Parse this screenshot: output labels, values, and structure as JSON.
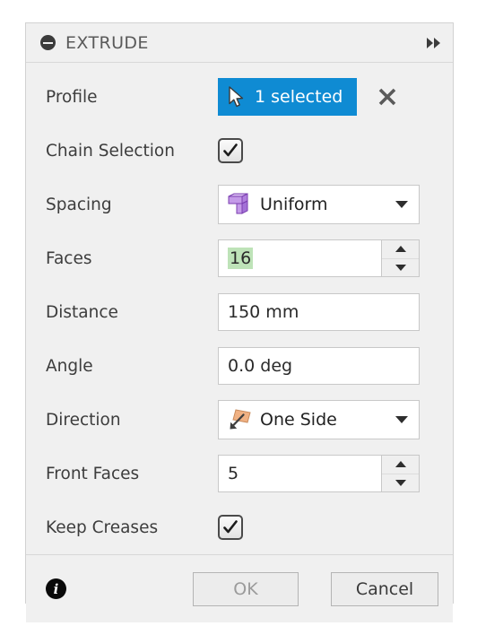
{
  "panel": {
    "title": "EXTRUDE",
    "collapse_icon": "collapse-minus-icon",
    "expand_icon": "fast-forward-icon",
    "accent_blue": "#0f8bd3",
    "highlight_green": "#bee3b8"
  },
  "rows": {
    "profile": {
      "label": "Profile",
      "button_text": "1 selected",
      "button_icon": "cursor-arrow-icon",
      "clear_icon": "close-x-icon"
    },
    "chain_selection": {
      "label": "Chain Selection",
      "checked": true
    },
    "spacing": {
      "label": "Spacing",
      "value": "Uniform",
      "icon": "extrude-uniform-icon"
    },
    "faces": {
      "label": "Faces",
      "value": "16",
      "selected": true
    },
    "distance": {
      "label": "Distance",
      "value": "150 mm"
    },
    "angle": {
      "label": "Angle",
      "value": "0.0 deg"
    },
    "direction": {
      "label": "Direction",
      "value": "One Side",
      "icon": "one-side-direction-icon"
    },
    "front_faces": {
      "label": "Front Faces",
      "value": "5",
      "selected": false
    },
    "keep_creases": {
      "label": "Keep Creases",
      "checked": true
    }
  },
  "footer": {
    "info_icon": "info-icon",
    "info_glyph": "i",
    "ok_label": "OK",
    "cancel_label": "Cancel"
  }
}
